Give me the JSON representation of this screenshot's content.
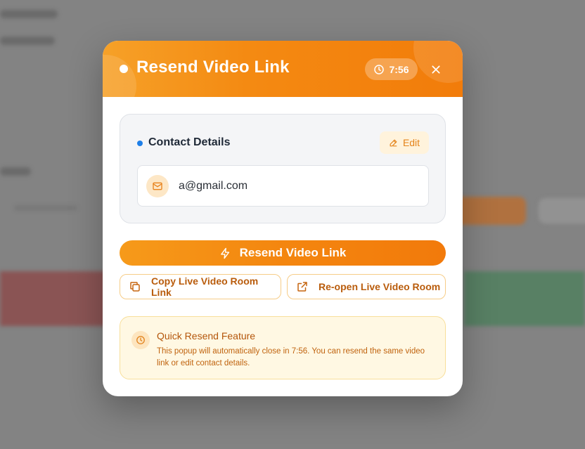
{
  "modal": {
    "title": "Resend Video Link",
    "timer": "7:56"
  },
  "contact": {
    "section_title": "Contact Details",
    "edit_label": "Edit",
    "email": "a@gmail.com"
  },
  "actions": {
    "resend_label": "Resend Video Link",
    "copy_label": "Copy Live Video Room Link",
    "reopen_label": "Re-open Live Video Room"
  },
  "info": {
    "title": "Quick Resend Feature",
    "text": "This popup will automatically close in 7:56. You can resend the same video link or edit contact details."
  },
  "icons": {
    "timer": "clock-icon",
    "close": "close-icon",
    "edit": "pencil-icon",
    "email": "mail-icon",
    "resend": "lightning-icon",
    "copy": "copy-icon",
    "reopen": "external-link-icon",
    "info": "clock-icon"
  },
  "colors": {
    "accent": "#f48a12",
    "accent_dark": "#b95c0c",
    "info_bg": "#fff8e3",
    "status_dot": "#1e7fe8"
  }
}
